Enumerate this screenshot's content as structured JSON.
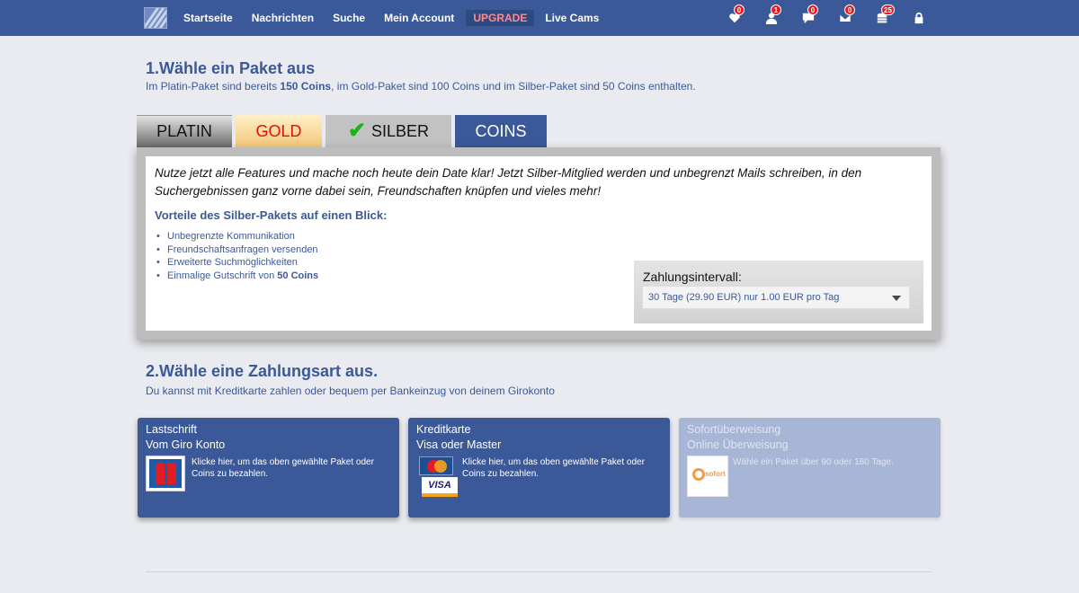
{
  "nav": {
    "items": [
      {
        "label": "Startseite",
        "name": "nav-startseite"
      },
      {
        "label": "Nachrichten",
        "name": "nav-nachrichten"
      },
      {
        "label": "Suche",
        "name": "nav-suche"
      },
      {
        "label": "Mein Account",
        "name": "nav-mein-account"
      },
      {
        "label": "UPGRADE",
        "name": "nav-upgrade"
      },
      {
        "label": "Live Cams",
        "name": "nav-live-cams"
      }
    ],
    "icons": [
      {
        "icon": "heart-icon",
        "count": "0"
      },
      {
        "icon": "user-icon",
        "count": "1"
      },
      {
        "icon": "chat-icon",
        "count": "0"
      },
      {
        "icon": "mail-icon",
        "count": "0"
      },
      {
        "icon": "coins-icon",
        "count": "25"
      },
      {
        "icon": "lock-icon",
        "count": ""
      }
    ]
  },
  "section1": {
    "title": "1.Wähle ein Paket aus",
    "sub_prefix": "Im Platin-Paket sind bereits ",
    "sub_bold": "150 Coins",
    "sub_suffix": ", im Gold-Paket sind 100 Coins und im Silber-Paket sind 50 Coins enthalten."
  },
  "tabs": {
    "platin": "PLATIN",
    "gold": "GOLD",
    "silber": "SILBER",
    "coins": "COINS",
    "selected": "silber"
  },
  "package": {
    "intro": "Nutze jetzt alle Features und mache noch heute dein Date klar! Jetzt Silber-Mitglied werden und unbegrenzt Mails schreiben, in den Suchergebnissen ganz vorne dabei sein, Freundschaften knüpfen und vieles mehr!",
    "benefits_title": "Vorteile des Silber-Pakets auf einen Blick:",
    "benefits": [
      "Unbegrenzte Kommunikation",
      "Freundschaftsanfragen versenden",
      "Erweiterte Suchmöglichkeiten"
    ],
    "benefit_last_prefix": "Einmalige Gutschrift von ",
    "benefit_last_bold": "50 Coins",
    "interval_label": "Zahlungsintervall:",
    "interval_value": "30 Tage (29.90 EUR) nur 1.00 EUR pro Tag"
  },
  "section2": {
    "title": "2.Wähle eine Zahlungsart aus.",
    "sub": "Du kannst mit Kreditkarte zahlen oder bequem per Bankeinzug von deinem Girokonto"
  },
  "payments": [
    {
      "t1": "Lastschrift",
      "t2": "Vom Giro Konto",
      "desc": "Klicke hier, um das oben gewählte Paket oder Coins zu bezahlen."
    },
    {
      "t1": "Kreditkarte",
      "t2": "Visa oder Master",
      "desc": "Klicke hier, um das oben gewählte Paket oder Coins zu bezahlen.",
      "visa": "VISA",
      "mc": "MasterCard"
    },
    {
      "t1": "Sofortüberweisung",
      "t2": "Online Überweisung",
      "desc": "Wähle ein Paket über 90 oder 180 Tage.",
      "logo_text": "sofort"
    }
  ]
}
